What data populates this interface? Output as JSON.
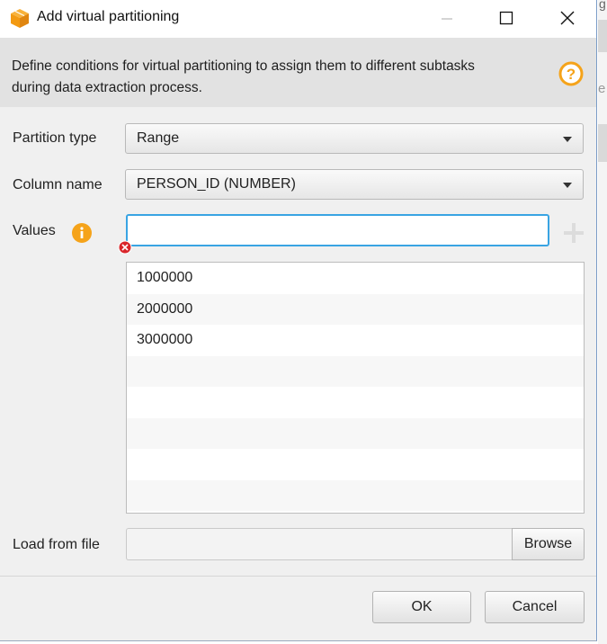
{
  "window": {
    "title": "Add virtual partitioning"
  },
  "header": {
    "description": "Define conditions for virtual partitioning to assign them to different subtasks during data extraction process."
  },
  "form": {
    "partition_type": {
      "label": "Partition type",
      "value": "Range"
    },
    "column_name": {
      "label": "Column name",
      "value": "PERSON_ID (NUMBER)"
    },
    "values": {
      "label": "Values",
      "input_value": "",
      "items": [
        "1000000",
        "2000000",
        "3000000",
        "",
        "",
        "",
        "",
        ""
      ]
    },
    "load_from_file": {
      "label": "Load from file",
      "value": "",
      "browse_label": "Browse"
    }
  },
  "buttons": {
    "ok": "OK",
    "cancel": "Cancel"
  },
  "background": {
    "fragment_top": "g",
    "fragment_mid": "e"
  },
  "colors": {
    "accent": "#39a4e3",
    "warning": "#f5a623",
    "error": "#d9262b",
    "icon_orange": "#f5a31a"
  },
  "icons": {
    "app": "aws-box-icon",
    "help": "help-question-icon",
    "info": "info-icon",
    "error": "error-icon",
    "add": "plus-icon"
  }
}
